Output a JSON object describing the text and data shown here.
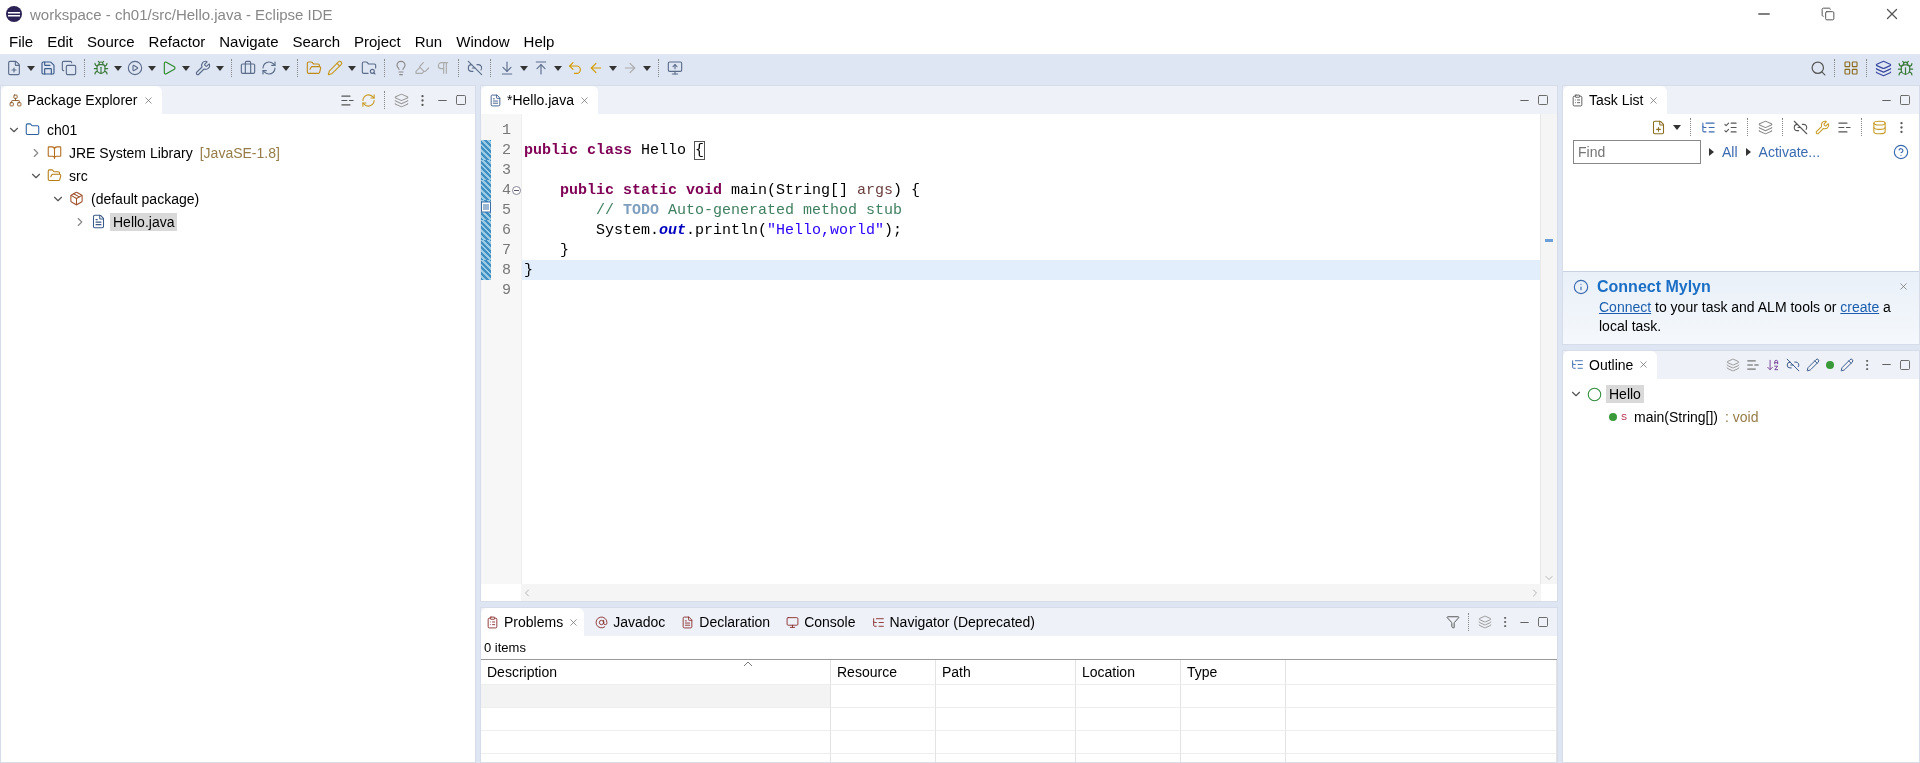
{
  "window": {
    "title": "workspace - ch01/src/Hello.java - Eclipse IDE"
  },
  "menu": [
    "File",
    "Edit",
    "Source",
    "Refactor",
    "Navigate",
    "Search",
    "Project",
    "Run",
    "Window",
    "Help"
  ],
  "package_explorer": {
    "title": "Package Explorer",
    "tree": [
      {
        "label": "ch01",
        "kind": "project",
        "expanded": true,
        "selected": false,
        "children": [
          {
            "label": "JRE System Library",
            "decoration": "[JavaSE-1.8]",
            "kind": "library",
            "expanded": false,
            "selected": false
          },
          {
            "label": "src",
            "kind": "folder",
            "expanded": true,
            "selected": false,
            "children": [
              {
                "label": "(default package)",
                "kind": "package",
                "expanded": true,
                "selected": false,
                "children": [
                  {
                    "label": "Hello.java",
                    "kind": "file",
                    "expanded": false,
                    "selected": true
                  }
                ]
              }
            ]
          }
        ]
      }
    ]
  },
  "editor": {
    "tab": "*Hello.java",
    "lines": [
      {
        "number": "1",
        "changed": false,
        "fold": false,
        "task": false,
        "current": false
      },
      {
        "number": "2",
        "changed": true,
        "fold": false,
        "task": false,
        "current": false,
        "tokens": [
          {
            "kind": "keyword",
            "text": "public class"
          },
          {
            "kind": "plain",
            "text": " Hello "
          },
          {
            "kind": "bracket",
            "text": "{"
          }
        ]
      },
      {
        "number": "3",
        "changed": true,
        "fold": false,
        "task": false,
        "current": false
      },
      {
        "number": "4",
        "changed": true,
        "fold": true,
        "task": false,
        "current": false,
        "tokens": [
          {
            "kind": "keyword",
            "text": "    public static void"
          },
          {
            "kind": "plain",
            "text": " main(String[] "
          },
          {
            "kind": "param",
            "text": "args"
          },
          {
            "kind": "plain",
            "text": ") {"
          }
        ]
      },
      {
        "number": "5",
        "changed": true,
        "fold": false,
        "task": true,
        "current": false,
        "tokens": [
          {
            "kind": "comment",
            "text": "        // "
          },
          {
            "kind": "todo",
            "text": "TODO"
          },
          {
            "kind": "comment",
            "text": " Auto-generated method stub"
          }
        ]
      },
      {
        "number": "6",
        "changed": true,
        "fold": false,
        "task": false,
        "current": false,
        "tokens": [
          {
            "kind": "plain",
            "text": "        System."
          },
          {
            "kind": "field",
            "text": "out"
          },
          {
            "kind": "plain",
            "text": ".println("
          },
          {
            "kind": "string",
            "text": "\"Hello,world\""
          },
          {
            "kind": "plain",
            "text": ");"
          }
        ]
      },
      {
        "number": "7",
        "changed": true,
        "fold": false,
        "task": false,
        "current": false,
        "tokens": [
          {
            "kind": "plain",
            "text": "    }"
          }
        ]
      },
      {
        "number": "8",
        "changed": true,
        "fold": false,
        "task": false,
        "current": true,
        "tokens": [
          {
            "kind": "plain",
            "text": "}"
          }
        ]
      },
      {
        "number": "9",
        "changed": false,
        "fold": false,
        "task": false,
        "current": false
      }
    ]
  },
  "task_list": {
    "title": "Task List",
    "find_placeholder": "Find",
    "links": [
      "All",
      "Activate..."
    ]
  },
  "mylyn": {
    "title": "Connect Mylyn",
    "message": [
      {
        "kind": "link",
        "text": "Connect"
      },
      {
        "kind": "text",
        "text": " to your task and ALM tools or "
      },
      {
        "kind": "link",
        "text": "create"
      },
      {
        "kind": "text",
        "text": " a local task."
      }
    ]
  },
  "outline": {
    "title": "Outline",
    "tree": [
      {
        "label": "Hello",
        "kind": "class",
        "expanded": true,
        "selected": true,
        "children": [
          {
            "label": "main(String[])",
            "type": " : void",
            "modifier": "S",
            "kind": "method",
            "selected": false
          }
        ]
      }
    ]
  },
  "bottom": {
    "tabs": [
      {
        "label": "Problems",
        "selected": true
      },
      {
        "label": "Javadoc",
        "selected": false
      },
      {
        "label": "Declaration",
        "selected": false
      },
      {
        "label": "Console",
        "selected": false
      },
      {
        "label": "Navigator (Deprecated)",
        "selected": false
      }
    ],
    "summary": "0 items",
    "columns": [
      {
        "label": "Description",
        "sorted": true
      },
      {
        "label": "Resource",
        "sorted": false
      },
      {
        "label": "Path",
        "sorted": false
      },
      {
        "label": "Location",
        "sorted": false
      },
      {
        "label": "Type",
        "sorted": false
      }
    ]
  }
}
